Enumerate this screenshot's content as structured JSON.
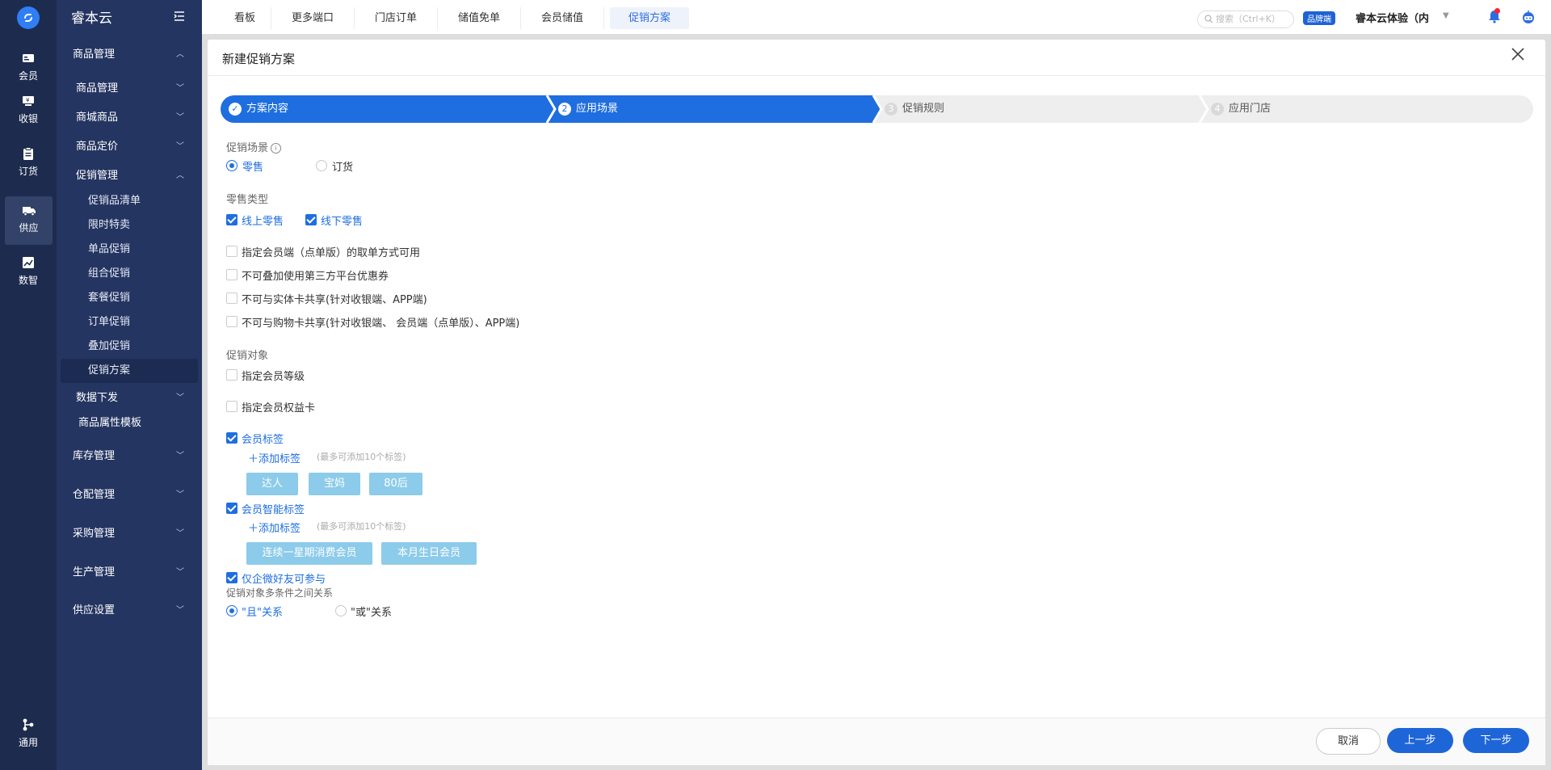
{
  "rail": {
    "items": [
      {
        "label": "会员",
        "icon": "member-card-icon"
      },
      {
        "label": "收银",
        "icon": "cashier-icon"
      },
      {
        "label": "订货",
        "icon": "order-clipboard-icon"
      },
      {
        "label": "供应",
        "icon": "truck-icon"
      },
      {
        "label": "数智",
        "icon": "chart-trend-icon"
      },
      {
        "label": "通用",
        "icon": "share-nodes-icon"
      }
    ],
    "active": "供应"
  },
  "menu": {
    "brand": "睿本云",
    "groups": {
      "product_mgmt": "商品管理",
      "product_mgmt_sub": "商品管理",
      "mall_goods": "商城商品",
      "pricing": "商品定价",
      "promo_mgmt": "促销管理",
      "promo_items": [
        "促销品清单",
        "限时特卖",
        "单品促销",
        "组合促销",
        "套餐促销",
        "订单促销",
        "叠加促销",
        "促销方案"
      ],
      "data_dispatch": "数据下发",
      "attr_template": "商品属性模板",
      "inventory": "库存管理",
      "warehouse": "仓配管理",
      "purchase": "采购管理",
      "production": "生产管理",
      "supply_settings": "供应设置"
    }
  },
  "topbar": {
    "tabs": [
      "看板",
      "更多端口",
      "门店订单",
      "储值免单",
      "会员储值",
      "促销方案"
    ],
    "active_tab": "促销方案",
    "search_placeholder": "搜索（Ctrl+K）",
    "brand_badge": "品牌端",
    "org_name": "睿本云体验（内"
  },
  "dialog": {
    "title": "新建促销方案",
    "steps": [
      {
        "num": "✓",
        "label": "方案内容"
      },
      {
        "num": "2",
        "label": "应用场景"
      },
      {
        "num": "3",
        "label": "促销规则"
      },
      {
        "num": "4",
        "label": "应用门店"
      }
    ],
    "scene": {
      "label": "促销场景",
      "info": "i",
      "options": [
        "零售",
        "订货"
      ],
      "selected": "零售"
    },
    "retail_type": {
      "label": "零售类型",
      "options": [
        {
          "label": "线上零售",
          "checked": true
        },
        {
          "label": "线下零售",
          "checked": true
        }
      ]
    },
    "flags": [
      {
        "label": "指定会员端（点单版）的取单方式可用",
        "checked": false
      },
      {
        "label": "不可叠加使用第三方平台优惠券",
        "checked": false
      },
      {
        "label": "不可与实体卡共享(针对收银端、APP端)",
        "checked": false
      },
      {
        "label": "不可与购物卡共享(针对收银端、 会员端（点单版）、APP端)",
        "checked": false
      }
    ],
    "target": {
      "label": "促销对象",
      "member_level": {
        "label": "指定会员等级",
        "checked": false
      },
      "member_card": {
        "label": "指定会员权益卡",
        "checked": false
      },
      "member_tags": {
        "label": "会员标签",
        "checked": true,
        "add": "添加标签",
        "hint": "(最多可添加10个标签)",
        "tags": [
          "达人",
          "宝妈",
          "80后"
        ]
      },
      "smart_tags": {
        "label": "会员智能标签",
        "checked": true,
        "add": "添加标签",
        "hint": "(最多可添加10个标签)",
        "tags": [
          "连续一星期消费会员",
          "本月生日会员"
        ]
      },
      "wecom_only": {
        "label": "仅企微好友可参与",
        "checked": true
      },
      "relation_label": "促销对象多条件之间关系",
      "relations": [
        "\"且\"关系",
        "\"或\"关系"
      ],
      "relation_selected": "\"且\"关系"
    },
    "footer": {
      "cancel": "取消",
      "prev": "上一步",
      "next": "下一步"
    }
  },
  "colors": {
    "primary": "#1e6ee0",
    "rail_bg": "#1d2b4e",
    "menu_bg": "#253561",
    "tag_bg": "#8ccbe9"
  }
}
